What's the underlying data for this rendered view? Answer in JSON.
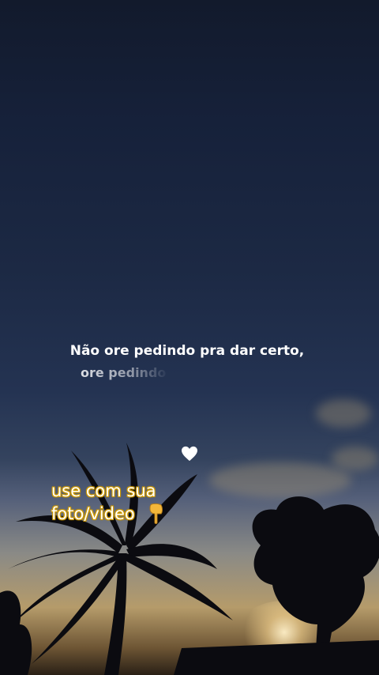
{
  "scene": {
    "description_icon": "sunset-sky-palm-silhouette"
  },
  "caption": {
    "line1": "Não ore pedindo pra dar certo,",
    "line2": "ore pedindo"
  },
  "sticker": {
    "line1": "use com sua",
    "line2": "foto/video"
  },
  "icons": {
    "heart": "white-heart-icon",
    "hand": "pointing-down-hand-icon"
  },
  "colors": {
    "sky_top": "#121a2c",
    "sticker_outline": "#d9a400",
    "heart": "#ffffff"
  }
}
